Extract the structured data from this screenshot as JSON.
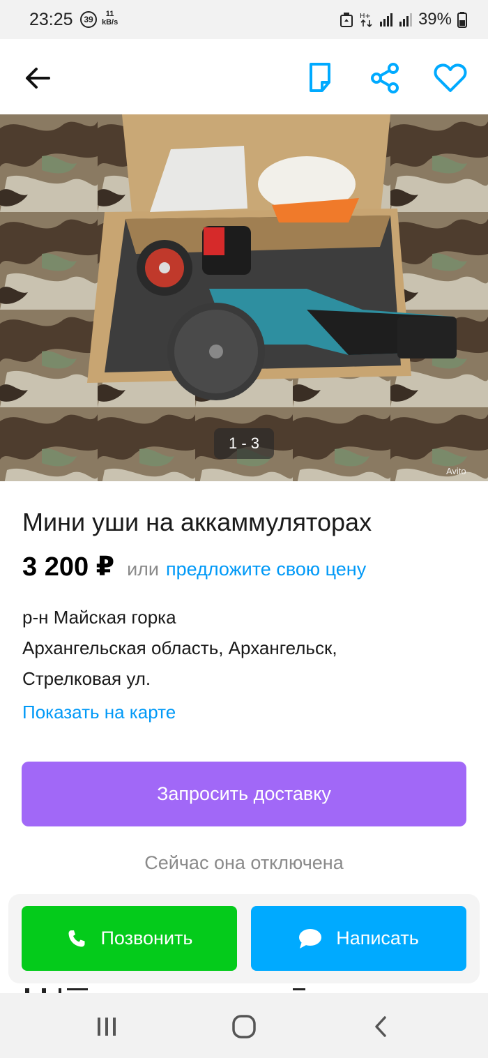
{
  "status_bar": {
    "time": "23:25",
    "notif_count": "39",
    "speed_value": "11",
    "speed_unit": "kB/s",
    "battery": "39%"
  },
  "header": {
    "back_icon": "arrow-left-icon",
    "note_icon": "note-icon",
    "share_icon": "share-icon",
    "favorite_icon": "heart-icon",
    "accent": "#00aaff"
  },
  "gallery": {
    "counter": "1 - 3",
    "watermark": "Avito"
  },
  "listing": {
    "title": "Мини уши на аккаммуляторах",
    "price": "3 200 ₽",
    "price_or": "или",
    "offer_link": "предложите свою цену",
    "district": "р-н Майская горка",
    "address_line1": "Архангельская область, Архангельск,",
    "address_line2": "Стрелковая ул.",
    "map_link": "Показать на карте"
  },
  "delivery": {
    "button_label": "Запросить доставку",
    "note": "Сейчас она отключена",
    "color": "#a168f7"
  },
  "actions": {
    "call_label": "Позвонить",
    "call_icon": "phone-icon",
    "call_color": "#04cb1b",
    "message_label": "Написать",
    "message_icon": "chat-bubble-icon",
    "message_color": "#00aaff"
  },
  "navigation": {
    "recent_icon": "recent-apps-icon",
    "home_icon": "home-icon",
    "back_icon": "back-chevron-icon"
  }
}
